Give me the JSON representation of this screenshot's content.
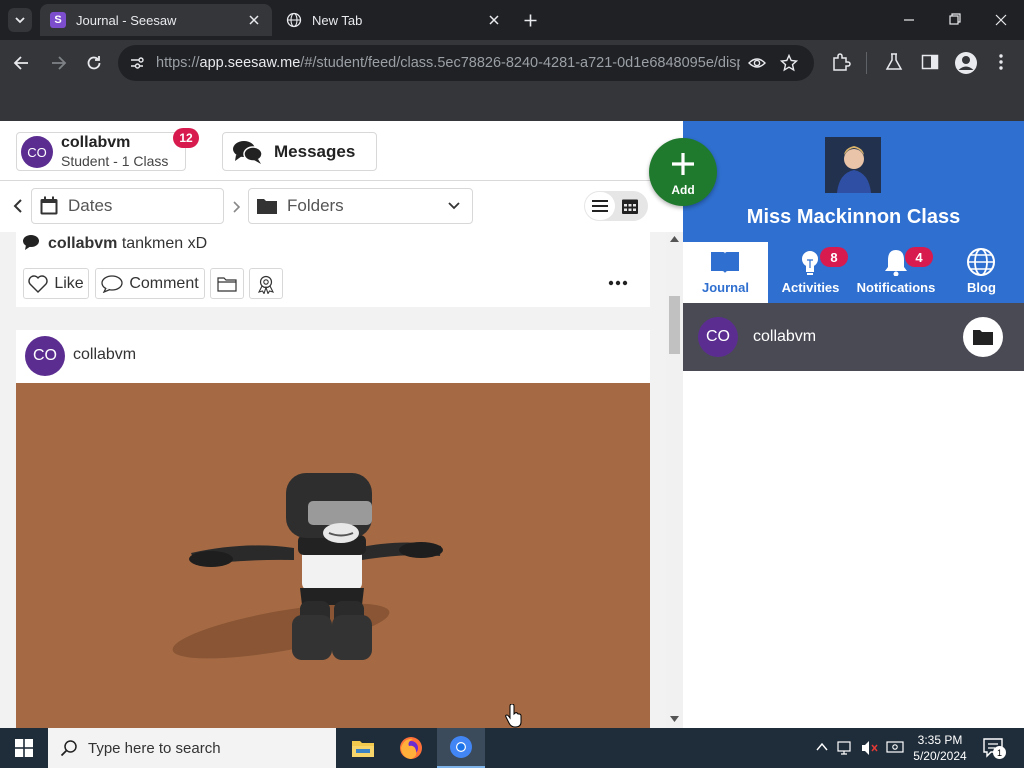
{
  "browser": {
    "tabs": [
      {
        "title": "Journal - Seesaw",
        "active": true
      },
      {
        "title": "New Tab",
        "active": false
      }
    ],
    "url": {
      "prefix": "https://",
      "host": "app.seesaw.me",
      "rest": "/#/student/feed/class.5ec78826-8240-4281-a721-0d1e6848095e/displ..."
    }
  },
  "header": {
    "user_initials": "CO",
    "user_name": "collabvm",
    "user_sub": "Student - 1 Class",
    "badge_count": "12",
    "messages_label": "Messages"
  },
  "filters": {
    "dates_label": "Dates",
    "folders_label": "Folders"
  },
  "post_prev": {
    "author": "collabvm",
    "comment": "tankmen xD",
    "like_label": "Like",
    "comment_label": "Comment"
  },
  "post": {
    "initials": "CO",
    "author": "collabvm"
  },
  "add": {
    "label": "Add"
  },
  "class_panel": {
    "name": "Miss Mackinnon Class",
    "nav": [
      {
        "label": "Journal",
        "badge": ""
      },
      {
        "label": "Activities",
        "badge": "8"
      },
      {
        "label": "Notifications",
        "badge": "4"
      },
      {
        "label": "Blog",
        "badge": ""
      }
    ],
    "student": {
      "initials": "CO",
      "name": "collabvm"
    }
  },
  "taskbar": {
    "search_placeholder": "Type here to search",
    "time": "3:35 PM",
    "date": "5/20/2024",
    "notif_count": "1"
  },
  "colors": {
    "seesaw_blue": "#2f6fcf",
    "add_green": "#1f7a2e",
    "badge_red": "#d81b4f",
    "avatar_purple": "#5b2d91",
    "canvas_brown": "#a56a44"
  }
}
